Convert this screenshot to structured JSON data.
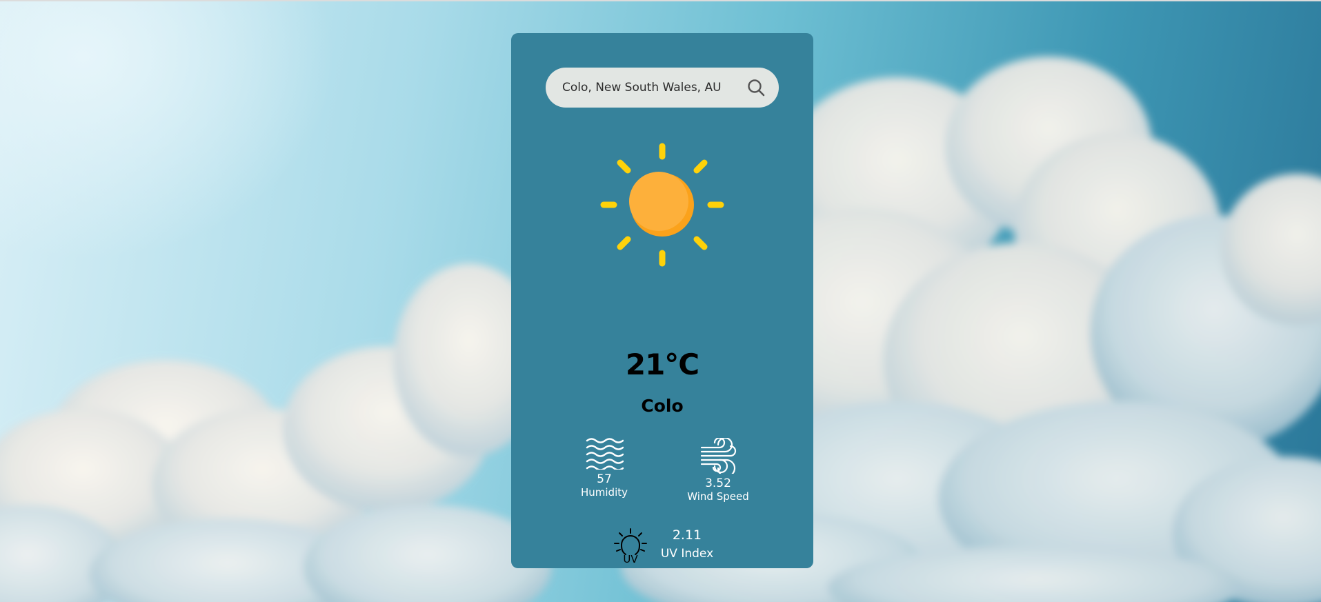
{
  "search": {
    "value": "Colo, New South Wales, AU",
    "icon": "search-icon"
  },
  "weather": {
    "icon": "sun-icon",
    "temperature": "21°C",
    "city": "Colo"
  },
  "stats": {
    "humidity": {
      "value": "57",
      "label": "Humidity",
      "icon": "waves-icon"
    },
    "wind": {
      "value": "3.52",
      "label": "Wind Speed",
      "icon": "wind-icon"
    },
    "uv": {
      "value": "2.11",
      "label": "UV Index",
      "icon": "uv-bulb-icon",
      "icon_text": "UV"
    }
  },
  "colors": {
    "card": "#36829b",
    "search_bg": "#e2e6e3",
    "sun_body": "#fdb03b",
    "sun_rays": "#ffd20a"
  }
}
